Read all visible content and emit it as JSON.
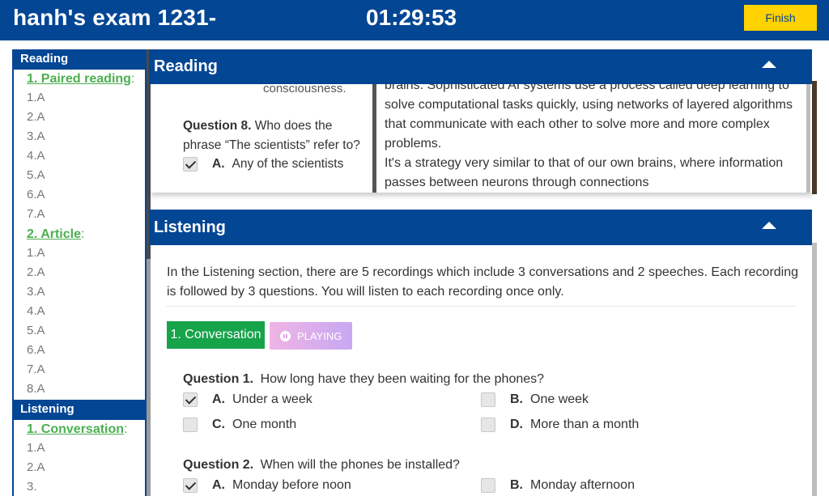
{
  "header": {
    "exam_title": "hanh's exam 1231-",
    "timer": "01:29:53",
    "finish_label": "Finish"
  },
  "sidebar": {
    "reading_title": "Reading",
    "listening_title": "Listening",
    "reading_parts": [
      {
        "label": "1. Paired reading",
        "items": [
          "1.A",
          "2.A",
          "3.A",
          "4.A",
          "5.A",
          "6.A",
          "7.A"
        ]
      },
      {
        "label": "2. Article",
        "items": [
          "1.A",
          "2.A",
          "3.A",
          "4.A",
          "5.A",
          "6.A",
          "7.A",
          "8.A"
        ]
      }
    ],
    "listening_parts": [
      {
        "label": "1. Conversation",
        "items": [
          "1.A",
          "2.A",
          "3."
        ]
      }
    ]
  },
  "reading": {
    "title": "Reading",
    "cutoff_text": "consciousness.",
    "question8_label": "Question 8.",
    "question8_text": "Who does the phrase “The scientists” refer to?",
    "question8_option_letter": "A.",
    "question8_option_text": "Any of the scientists",
    "passage_cut_top": "brains. Sophisticated AI systems use a process called deep learning to",
    "passage_line1": "solve computational tasks quickly, using networks of layered algorithms that communicate with each other to solve more and more complex problems.",
    "passage_line2": "It's a strategy very similar to that of our own brains, where information passes between neurons through connections"
  },
  "listening": {
    "title": "Listening",
    "intro": "In the Listening section, there are 5 recordings which include 3 conversations and 2 speeches. Each recording is followed by 3 questions. You will listen to each recording once only.",
    "conversation_button": "1. Conversation",
    "playing_label": "PLAYING",
    "questions": [
      {
        "label": "Question 1.",
        "text": "How long have they been waiting for the phones?",
        "options": [
          {
            "letter": "A.",
            "text": "Under a week",
            "checked": true
          },
          {
            "letter": "B.",
            "text": "One week",
            "checked": false
          },
          {
            "letter": "C.",
            "text": "One month",
            "checked": false
          },
          {
            "letter": "D.",
            "text": "More than a month",
            "checked": false
          }
        ]
      },
      {
        "label": "Question 2.",
        "text": "When will the phones be installed?",
        "options": [
          {
            "letter": "A.",
            "text": "Monday before noon",
            "checked": true
          },
          {
            "letter": "B.",
            "text": "Monday afternoon",
            "checked": false
          }
        ]
      }
    ]
  },
  "colors": {
    "primary": "#034694",
    "finish": "#ffd200",
    "link_green": "#4caf50",
    "conversation_green": "#16a34a"
  }
}
